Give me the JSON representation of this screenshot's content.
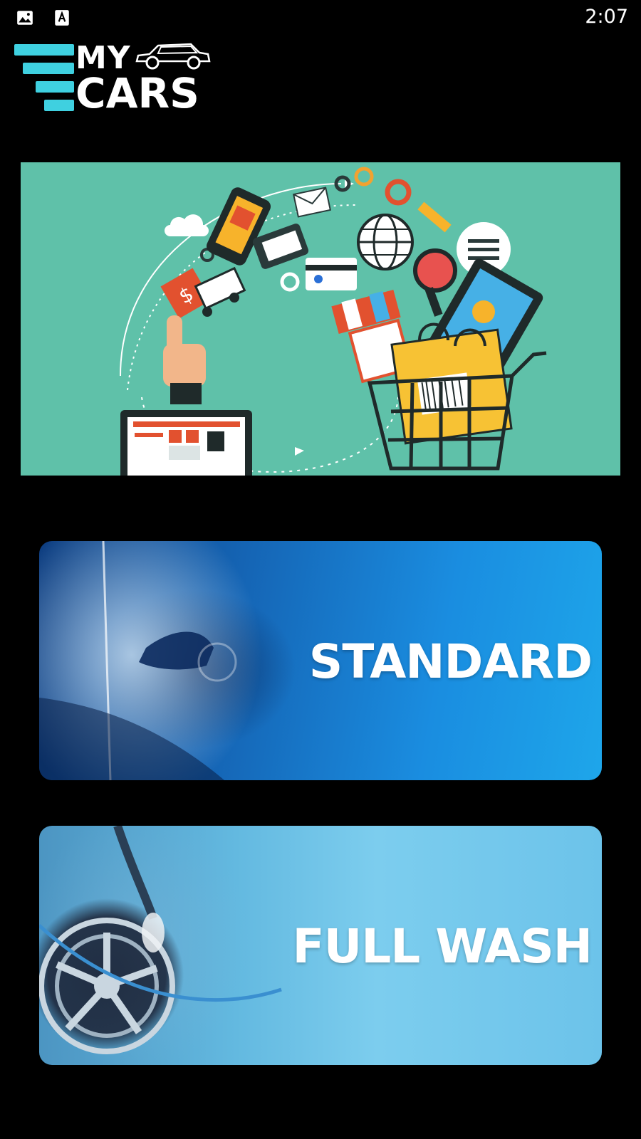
{
  "status_bar": {
    "time": "2:07",
    "icons": [
      "image-icon",
      "text-a-icon"
    ]
  },
  "logo": {
    "line1": "MY",
    "line2": "CARS",
    "icon": "car-icon",
    "accent_color": "#3fd0e0"
  },
  "banner": {
    "icon": "ecommerce-illustration",
    "background_color": "#5fc1a9"
  },
  "services": [
    {
      "label": "STANDARD",
      "icon": "car-wash-photo"
    },
    {
      "label": "FULL WASH",
      "icon": "wheel-wash-photo"
    }
  ]
}
